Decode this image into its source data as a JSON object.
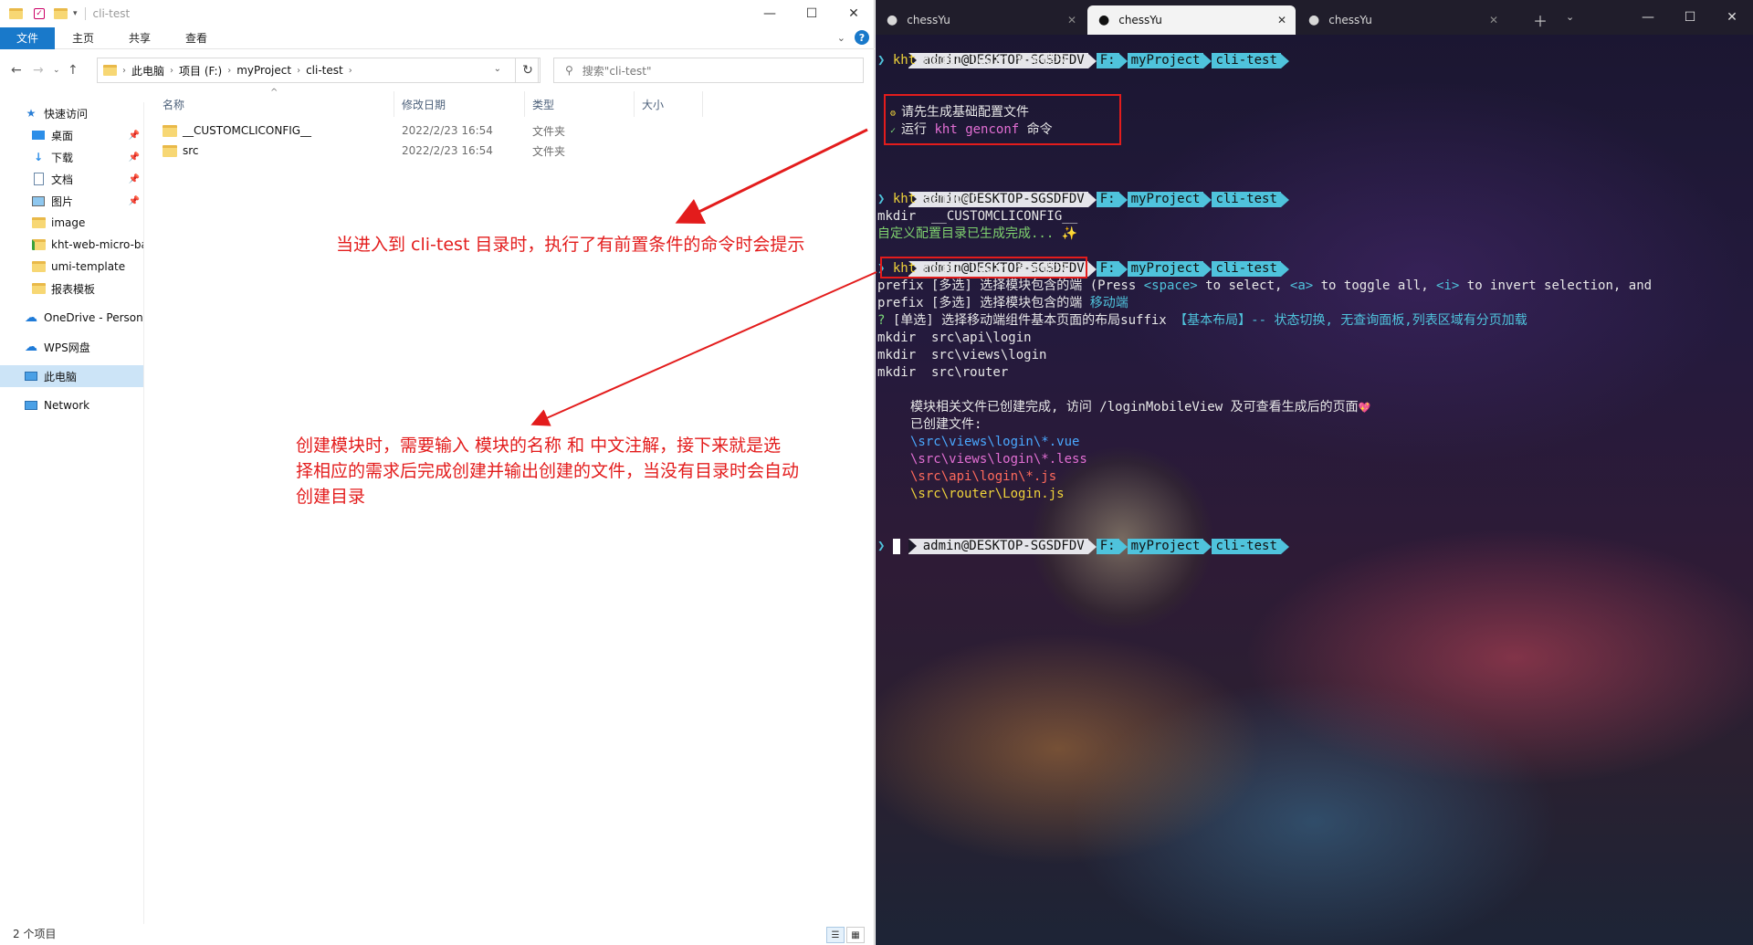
{
  "explorer": {
    "title": "cli-test",
    "ribbon_tabs": [
      "文件",
      "主页",
      "共享",
      "查看"
    ],
    "breadcrumb": [
      "此电脑",
      "项目 (F:)",
      "myProject",
      "cli-test"
    ],
    "search_placeholder": "搜索\"cli-test\"",
    "nav": {
      "quick_access": "快速访问",
      "items": [
        {
          "label": "桌面",
          "icon": "desktop-icon",
          "pinned": true
        },
        {
          "label": "下载",
          "icon": "download-icon",
          "pinned": true
        },
        {
          "label": "文档",
          "icon": "document-icon",
          "pinned": true
        },
        {
          "label": "图片",
          "icon": "picture-icon",
          "pinned": true
        },
        {
          "label": "image",
          "icon": "folder-icon",
          "pinned": false
        },
        {
          "label": "kht-web-micro-ba",
          "icon": "folder-check-icon",
          "pinned": false
        },
        {
          "label": "umi-template",
          "icon": "folder-icon",
          "pinned": false
        },
        {
          "label": "报表模板",
          "icon": "folder-icon",
          "pinned": false
        }
      ],
      "onedrive": "OneDrive - Persona",
      "wps": "WPS网盘",
      "this_pc": "此电脑",
      "network": "Network"
    },
    "columns": [
      "名称",
      "修改日期",
      "类型",
      "大小"
    ],
    "files": [
      {
        "name": "__CUSTOMCLICONFIG__",
        "date": "2022/2/23 16:54",
        "type": "文件夹"
      },
      {
        "name": "src",
        "date": "2022/2/23 16:54",
        "type": "文件夹"
      }
    ],
    "status": "2 个项目"
  },
  "annotations": {
    "a1": "当进入到 cli-test 目录时，执行了有前置条件的命令时会提示",
    "a2_l1": "创建模块时，需要输入 模块的名称 和 中文注解，接下来就是选",
    "a2_l2": "择相应的需求后完成创建并输出创建的文件，当没有目录时会自动",
    "a2_l3": "创建目录"
  },
  "terminal": {
    "tabs": [
      "chessYu",
      "chessYu",
      "chessYu"
    ],
    "active_tab": 1,
    "prompt": {
      "user": "admin@DESKTOP-SGSDFDV",
      "drive": "F:",
      "dir1": "myProject",
      "dir2": "cli-test"
    },
    "lines": {
      "cmd1_kw": "kht",
      "cmd1_rest": " model login 登录模块",
      "warn1": "请先生成基础配置文件",
      "warn2_a": "运行 ",
      "warn2_cmd": "kht genconf",
      "warn2_b": " 命令",
      "cmd2_kw": "kht",
      "cmd2_rest": " genconf",
      "mkdir1": "mkdir  __CUSTOMCLICONFIG__",
      "done1": "自定义配置目录已生成完成...",
      "sparkle": "✨",
      "cmd3_kw": "kht",
      "cmd3_rest": " model login 登录模块",
      "q1_a": "prefix [多选] 选择模块包含的端 (Press ",
      "q1_space": "<space>",
      "q1_b": " to select, ",
      "q1_a_key": "<a>",
      "q1_c": " to toggle all, ",
      "q1_i_key": "<i>",
      "q1_d": " to invert selection, and",
      "q2_a": "prefix [多选] 选择模块包含的端 ",
      "q2_ans": "移动端",
      "q3_mark": "?",
      "q3_a": " [单选] 选择移动端组件基本页面的布局suffix ",
      "q3_ans": "【基本布局】-- 状态切换, 无查询面板,列表区域有分页加载",
      "mk_a": "mkdir  src\\api\\login",
      "mk_b": "mkdir  src\\views\\login",
      "mk_c": "mkdir  src\\router",
      "created_msg": "模块相关文件已创建完成, 访问 /loginMobileView 及可查看生成后的页面",
      "heart": "💖",
      "created_files_label": "已创建文件:",
      "f1": "\\src\\views\\login\\*.vue",
      "f2": "\\src\\views\\login\\*.less",
      "f3": "\\src\\api\\login\\*.js",
      "f4": "\\src\\router\\Login.js"
    }
  }
}
